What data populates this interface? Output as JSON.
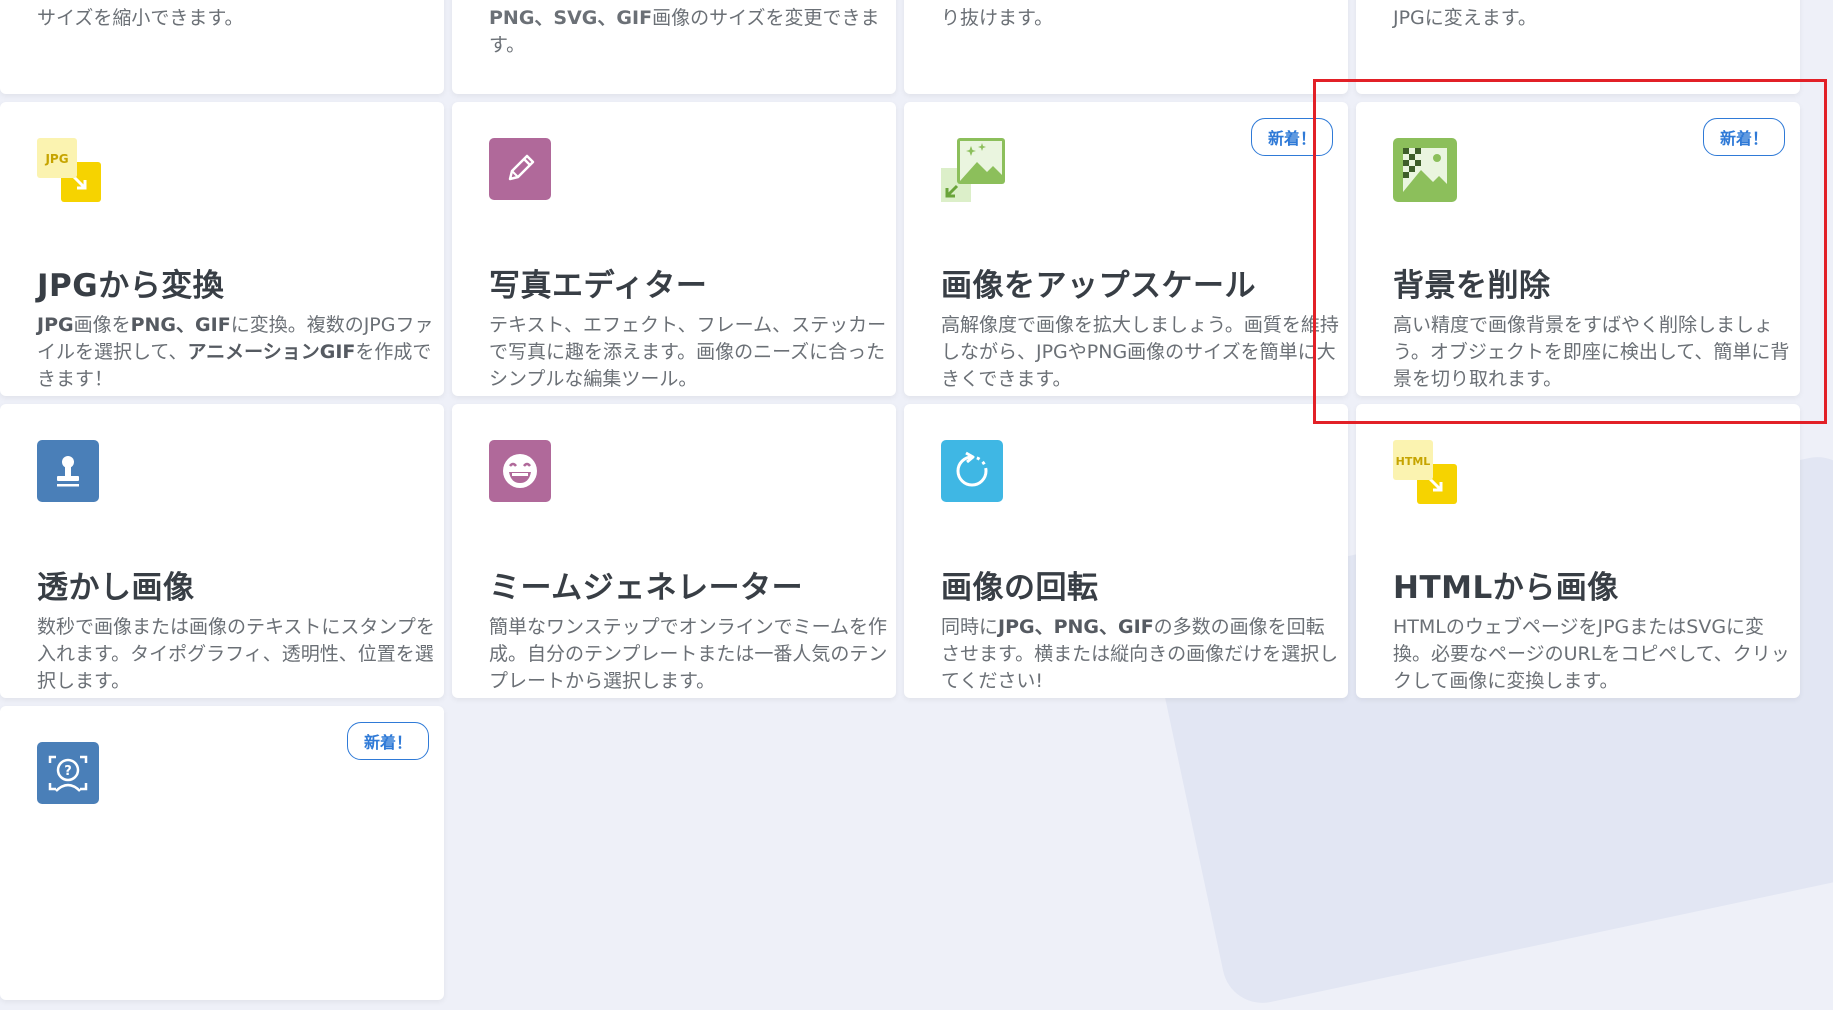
{
  "top_row": [
    {
      "desc": "サイズを縮小できます。"
    },
    {
      "desc_bold": "PNG、SVG、GIF",
      "desc": "画像のサイズを変更できます。"
    },
    {
      "desc": "り抜けます。"
    },
    {
      "desc": "JPGに変えます。"
    }
  ],
  "row1": [
    {
      "icon": "jpg-convert-icon",
      "icon_label": "JPG",
      "title": "JPGから変換",
      "desc_b1": "JPG",
      "desc_t1": "画像を",
      "desc_b2": "PNG、GIF",
      "desc_t2": "に変換。複数のJPGファイルを選択して、",
      "desc_b3": "アニメーションGIF",
      "desc_t3": "を作成できます！"
    },
    {
      "icon": "pencil-icon",
      "title": "写真エディター",
      "desc": "テキスト、エフェクト、フレーム、ステッカーで写真に趣を添えます。画像のニーズに合ったシンプルな編集ツール。"
    },
    {
      "icon": "upscale-image-icon",
      "badge": "新着！",
      "title": "画像をアップスケール",
      "desc": "高解像度で画像を拡大しましょう。画質を維持しながら、JPGやPNG画像のサイズを簡単に大きくできます。"
    },
    {
      "icon": "remove-background-icon",
      "badge": "新着！",
      "title": "背景を削除",
      "desc": "高い精度で画像背景をすばやく削除しましょう。オブジェクトを即座に検出して、簡単に背景を切り取れます。"
    }
  ],
  "row2": [
    {
      "icon": "stamp-icon",
      "title": "透かし画像",
      "desc": "数秒で画像または画像のテキストにスタンプを入れます。タイポグラフィ、透明性、位置を選択します。"
    },
    {
      "icon": "laughing-face-icon",
      "title": "ミームジェネレーター",
      "desc": "簡単なワンステップでオンラインでミームを作成。自分のテンプレートまたは一番人気のテンプレートから選択します。"
    },
    {
      "icon": "rotate-icon",
      "title": "画像の回転",
      "desc_t1": "同時に",
      "desc_b1": "JPG、PNG、GIF",
      "desc_t2": "の多数の画像を回転させます。横または縦向きの画像だけを選択してください!"
    },
    {
      "icon": "html-convert-icon",
      "icon_label": "HTML",
      "title": "HTMLから画像",
      "desc": "HTMLのウェブページをJPGまたはSVGに変換。必要なページのURLをコピペして、クリックして画像に変換します。"
    }
  ],
  "row3": [
    {
      "icon": "face-scan-icon",
      "badge": "新着！"
    }
  ],
  "colors": {
    "accent_blue": "#2f7ad7",
    "highlight_red": "#e22027",
    "jpg_yellow": "#f6d300",
    "editor_purple": "#b0699a",
    "upscale_green": "#8cbf5b",
    "stamp_blue": "#4a7fb8",
    "rotate_cyan": "#3fb7e4"
  }
}
